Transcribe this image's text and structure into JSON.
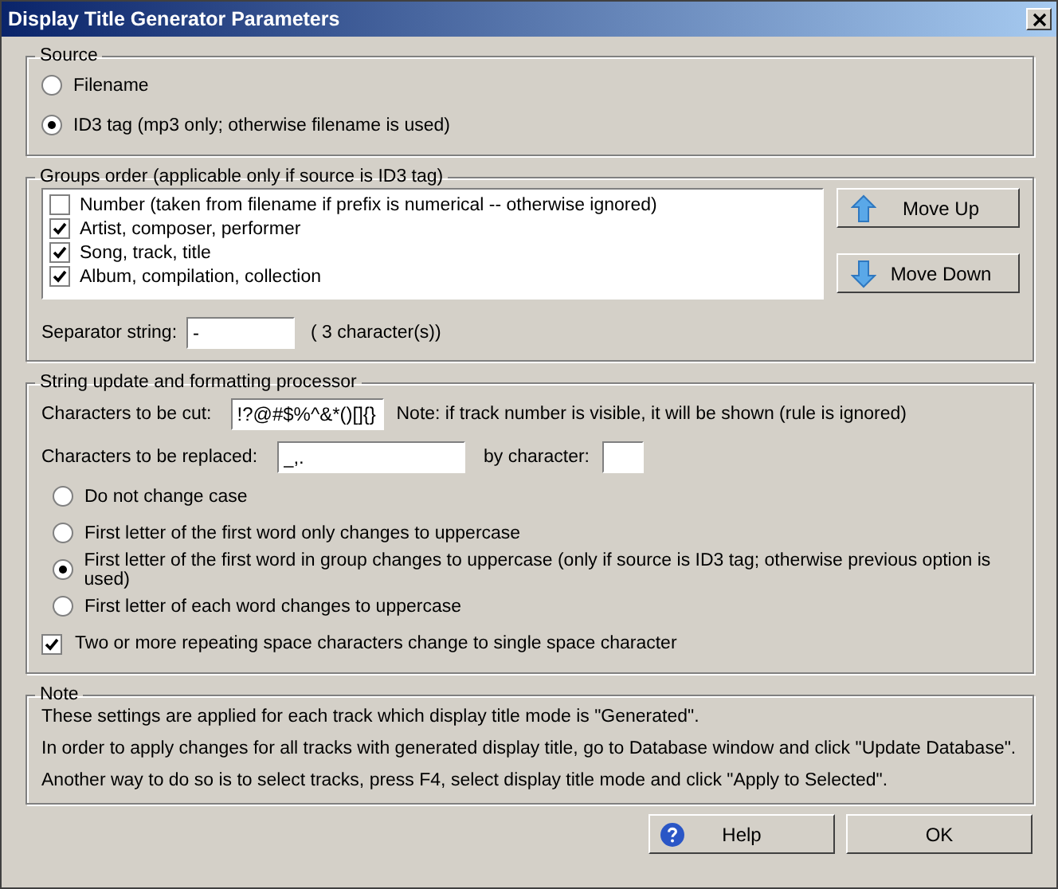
{
  "window": {
    "title": "Display Title Generator Parameters"
  },
  "source": {
    "title": "Source",
    "options": [
      {
        "label": "Filename",
        "selected": false
      },
      {
        "label": "ID3 tag (mp3 only; otherwise filename is used)",
        "selected": true
      }
    ]
  },
  "groups_order": {
    "title": "Groups order (applicable only if source is ID3 tag)",
    "items": [
      {
        "label": "Number (taken from filename if prefix is numerical -- otherwise ignored)",
        "checked": false
      },
      {
        "label": "Artist, composer, performer",
        "checked": true
      },
      {
        "label": "Song, track, title",
        "checked": true
      },
      {
        "label": "Album, compilation, collection",
        "checked": true
      }
    ],
    "buttons": [
      {
        "label": "Move Up",
        "kind": "up"
      },
      {
        "label": "Move Down",
        "kind": "down"
      }
    ],
    "separator_label": "Separator string:",
    "separator_value": "-",
    "separator_count": "( 3 character(s))"
  },
  "processor": {
    "title": "String update and formatting processor",
    "cut_label": "Characters to be cut:",
    "cut_value": "!?@#$%^&*()[]{}",
    "cut_note": "Note: if track number is visible, it will be shown (rule is ignored)",
    "replace_label": "Characters to be replaced:",
    "replace_value": "_,.",
    "by_label": "by character:",
    "case_options": [
      {
        "label": "Do not change case",
        "selected": false
      },
      {
        "label": "First letter of the first word only changes to uppercase",
        "selected": false
      },
      {
        "label": "First letter of the first word in group changes to uppercase (only if source is ID3 tag; otherwise previous option is used)",
        "selected": true
      },
      {
        "label": "First letter of each word changes to uppercase",
        "selected": false
      }
    ],
    "spaces": {
      "label": "Two or more repeating space characters change to single space character",
      "checked": true
    }
  },
  "note": {
    "title": "Note",
    "lines": [
      "These settings are applied for each track which display title mode is \"Generated\".",
      "In order to apply changes for all tracks with generated display title, go to Database window and click \"Update Database\".",
      "Another way to do so is to select tracks, press F4, select display title mode and click \"Apply to Selected\"."
    ]
  },
  "buttons": [
    {
      "label": "Help",
      "kind": "help"
    },
    {
      "label": "OK",
      "kind": "plain"
    }
  ]
}
